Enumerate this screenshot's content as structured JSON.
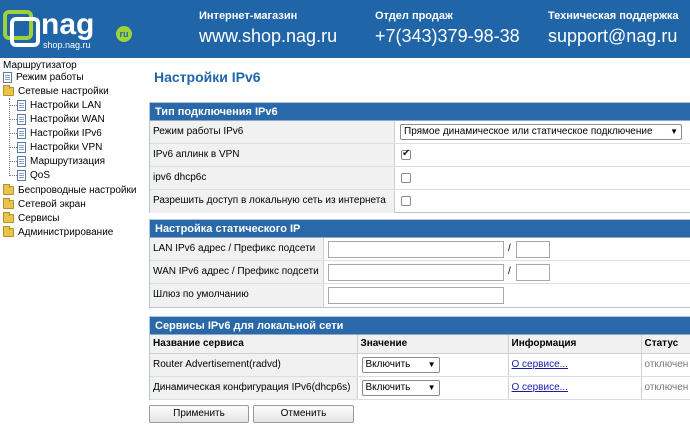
{
  "header": {
    "logo_text": "nag",
    "logo_sub": "shop.nag.ru",
    "logo_badge": "ru",
    "shop_caption": "Интернет-магазин",
    "shop_value": "www.shop.nag.ru",
    "sales_caption": "Отдел продаж",
    "sales_value": "+7(343)379-98-38",
    "support_caption": "Техническая поддержка",
    "support_value": "support@nag.ru",
    "bg_color": "#1f65a8"
  },
  "sidebar": {
    "root": "Маршрутизатор",
    "items": [
      {
        "label": "Режим работы",
        "icon": "document-icon"
      },
      {
        "label": "Сетевые настройки",
        "icon": "folder-icon"
      },
      {
        "label": "Настройки LAN",
        "icon": "document-icon"
      },
      {
        "label": "Настройки WAN",
        "icon": "document-icon"
      },
      {
        "label": "Настройки IPv6",
        "icon": "document-icon"
      },
      {
        "label": "Настройки VPN",
        "icon": "document-icon"
      },
      {
        "label": "Маршрутизация",
        "icon": "document-icon"
      },
      {
        "label": "QoS",
        "icon": "document-icon"
      },
      {
        "label": "Беспроводные настройки",
        "icon": "folder-icon"
      },
      {
        "label": "Сетевой экран",
        "icon": "folder-icon"
      },
      {
        "label": "Сервисы",
        "icon": "folder-icon"
      },
      {
        "label": "Администрирование",
        "icon": "folder-icon"
      }
    ]
  },
  "main": {
    "title": "Настройки IPv6",
    "conn": {
      "header": "Тип подключения IPv6",
      "mode_label": "Режим работы IPv6",
      "mode_value": "Прямое динамическое или статическое подключение",
      "vpn_label": "IPv6 аплинк в VPN",
      "vpn_checked": true,
      "dhcp_label": "ipv6 dhcp6c",
      "dhcp_checked": false,
      "access_label": "Разрешить доступ в локальную сеть из интернета",
      "access_checked": false
    },
    "static": {
      "header": "Настройка статического IP",
      "lan_label": "LAN IPv6 адрес / Префикс подсети",
      "wan_label": "WAN IPv6 адрес / Префикс подсети",
      "gw_label": "Шлюз по умолчанию",
      "slash": "/"
    },
    "services": {
      "header": "Сервисы IPv6 для локальной сети",
      "columns": [
        "Название сервиса",
        "Значение",
        "Информация",
        "Статус"
      ],
      "rows": [
        {
          "name": "Router Advertisement(radvd)",
          "value": "Включить",
          "info": "О сервисе...",
          "status": "отключен"
        },
        {
          "name": "Динамическая конфигурация IPv6(dhcp6s)",
          "value": "Включить",
          "info": "О сервисе...",
          "status": "отключен"
        }
      ]
    },
    "apply_label": "Применить",
    "cancel_label": "Отменить"
  }
}
